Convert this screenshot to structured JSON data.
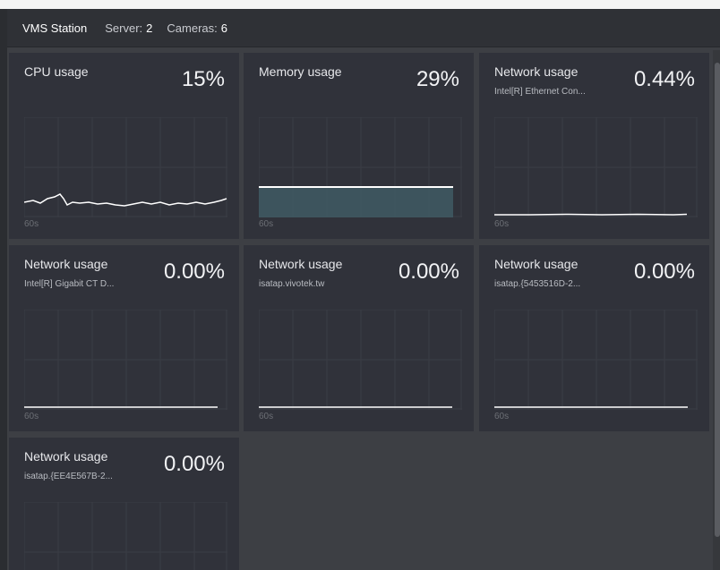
{
  "header": {
    "title": "VMS Station",
    "server_label": "Server:",
    "server_value": "2",
    "cameras_label": "Cameras:",
    "cameras_value": "6"
  },
  "panels": [
    {
      "label": "CPU usage",
      "sublabel": "",
      "value": "15%",
      "axis": "60s",
      "kind": "cpu"
    },
    {
      "label": "Memory usage",
      "sublabel": "",
      "value": "29%",
      "axis": "60s",
      "kind": "memory"
    },
    {
      "label": "Network usage",
      "sublabel": "Intel[R] Ethernet Con...",
      "value": "0.44%",
      "axis": "60s",
      "kind": "flat"
    },
    {
      "label": "Network usage",
      "sublabel": "Intel[R] Gigabit CT D...",
      "value": "0.00%",
      "axis": "60s",
      "kind": "flat"
    },
    {
      "label": "Network usage",
      "sublabel": "isatap.vivotek.tw",
      "value": "0.00%",
      "axis": "60s",
      "kind": "flat"
    },
    {
      "label": "Network usage",
      "sublabel": "isatap.{5453516D-2...",
      "value": "0.00%",
      "axis": "60s",
      "kind": "flat"
    },
    {
      "label": "Network usage",
      "sublabel": "isatap.{EE4E567B-2...",
      "value": "0.00%",
      "axis": "",
      "kind": "flat"
    }
  ],
  "colors": {
    "background": "#3d3f44",
    "panel": "#30323a",
    "line": "#ffffff",
    "memory_fill": "#3f5a64"
  }
}
